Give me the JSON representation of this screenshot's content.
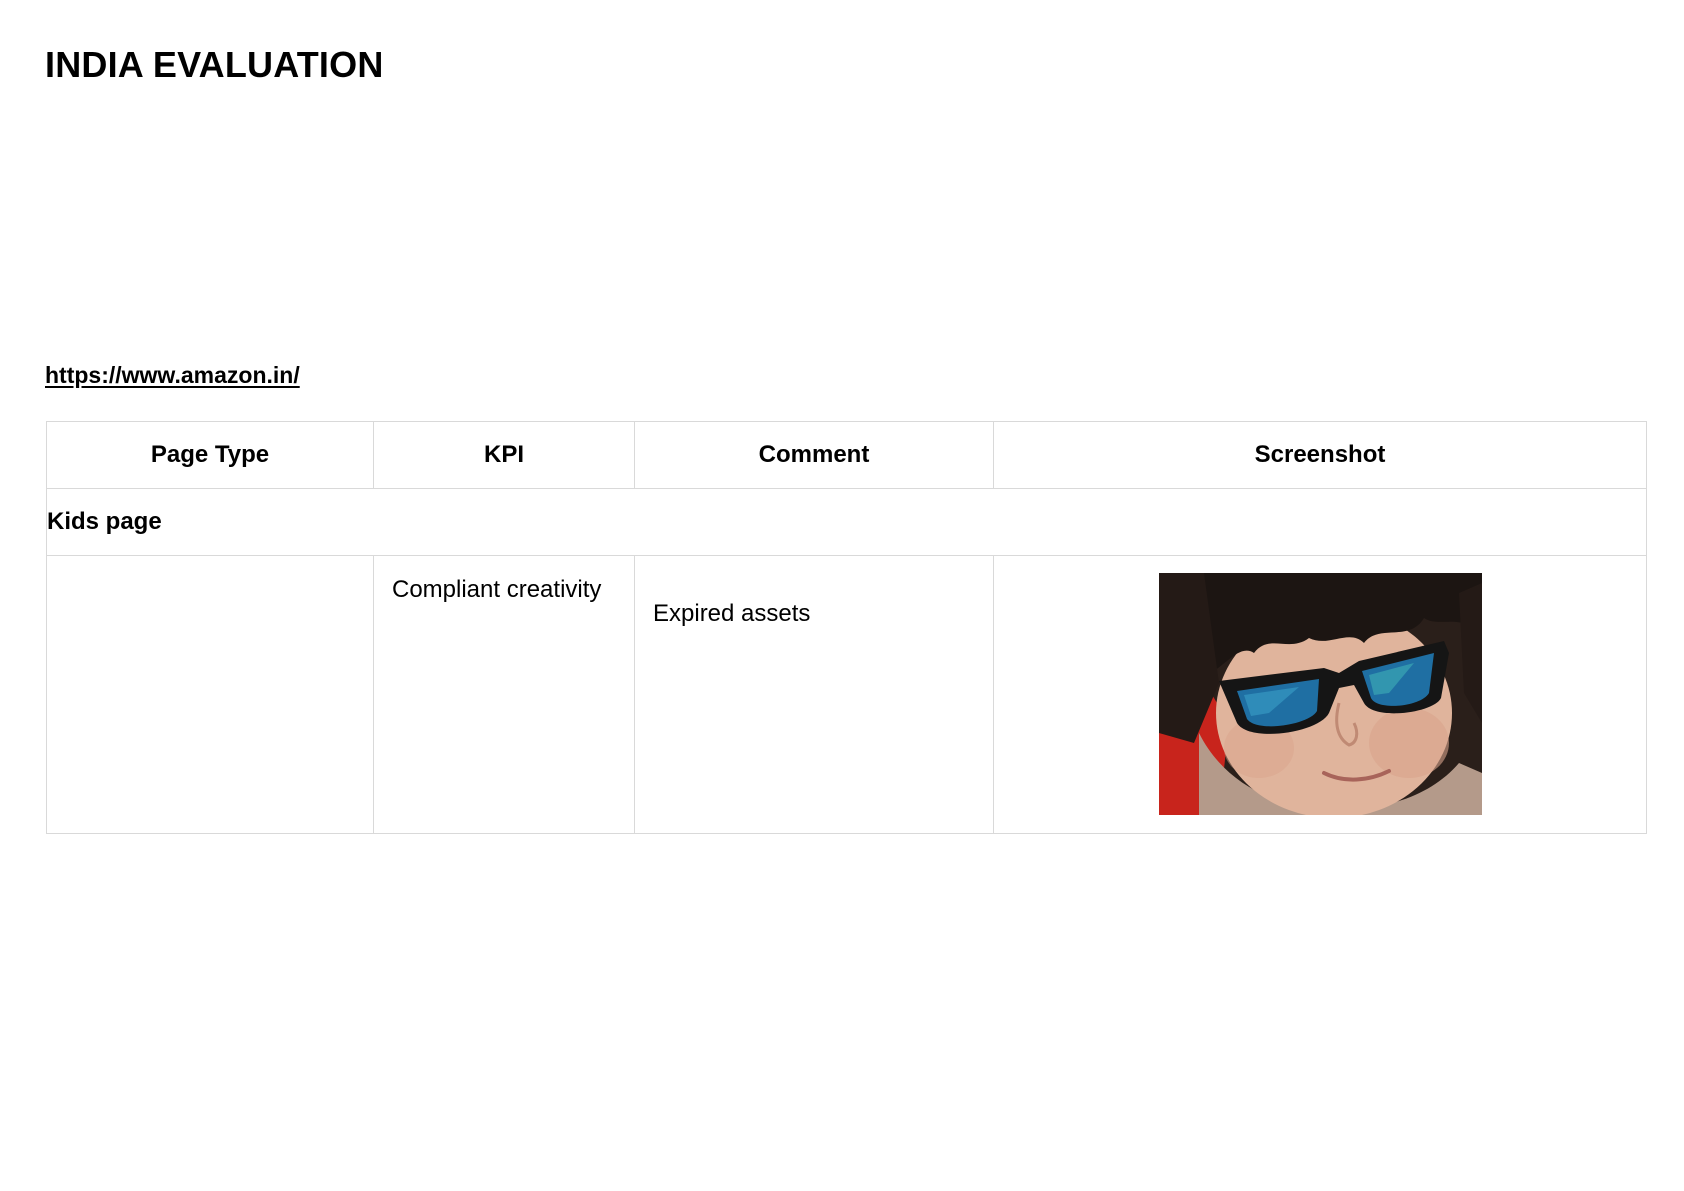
{
  "document": {
    "title": "INDIA EVALUATION",
    "url": "https://www.amazon.in/"
  },
  "table": {
    "headers": {
      "page_type": "Page Type",
      "kpi": "KPI",
      "comment": "Comment",
      "screenshot": "Screenshot"
    },
    "section_label": "Kids page",
    "rows": [
      {
        "page_type": "",
        "kpi": "Compliant creativity",
        "comment": "Expired assets",
        "screenshot": "child-with-blue-mirrored-sunglasses"
      }
    ]
  },
  "colors": {
    "border": "#d9d9d9",
    "lens": "#1f6fa3",
    "background_red": "#c8241c"
  }
}
